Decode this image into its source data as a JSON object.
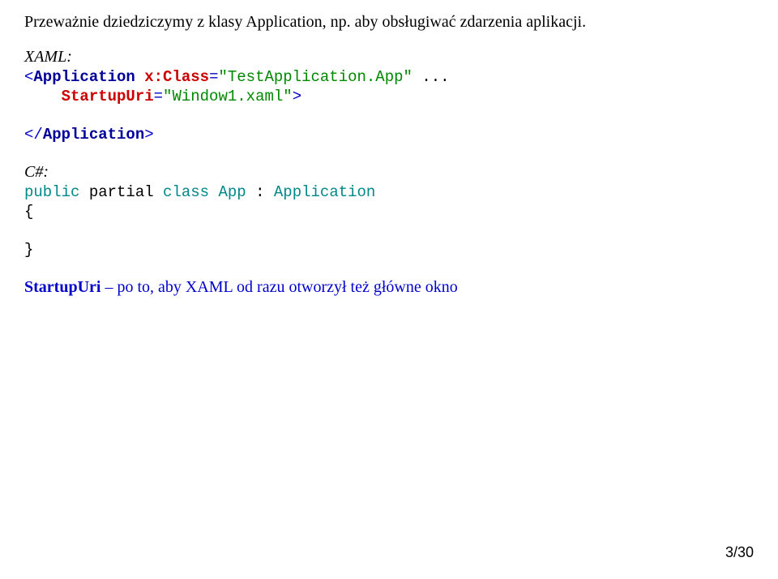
{
  "intro": "Przeważnie dziedziczymy z klasy Application, np. aby obsługiwać zdarzenia aplikacji.",
  "xaml": {
    "label": "XAML:",
    "lt1": "<",
    "tag1": "Application",
    "sp1": " ",
    "attr1": "x:Class",
    "eq": "=",
    "val1": "\"TestApplication.App\"",
    "ell": " ...",
    "indent": "    ",
    "attr2": "StartupUri",
    "val2": "\"Window1.xaml\"",
    "gt": ">",
    "lt2": "</",
    "tag2": "Application",
    "gt2": ">"
  },
  "csharp": {
    "label": "C#:",
    "kw_public": "public",
    "kw_partial": " partial ",
    "kw_class": "class",
    "sp": " ",
    "cls": "App",
    "colon": " : ",
    "base": "Application",
    "ob": "{",
    "cb": "}"
  },
  "footer": {
    "strong": "StartupUri",
    "rest": " – po to, aby XAML od razu otworzył też główne okno"
  },
  "page": "3/30"
}
